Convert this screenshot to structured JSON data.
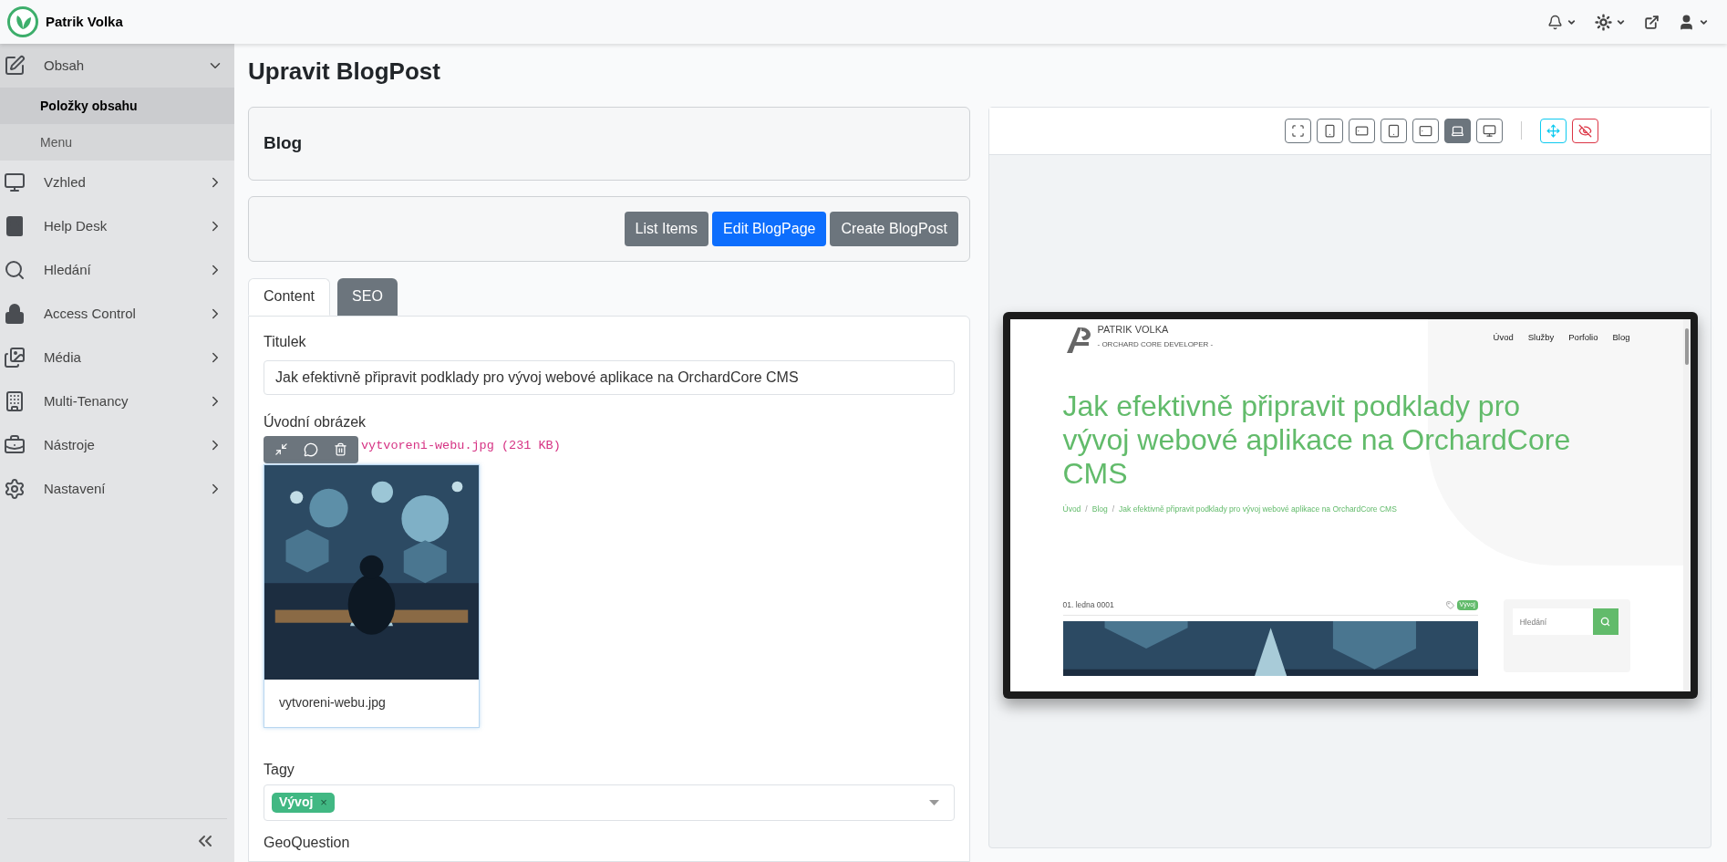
{
  "app": {
    "brand": "Patrik Volka"
  },
  "sidebar": {
    "items": [
      {
        "label": "Obsah",
        "expanded": true,
        "children": [
          {
            "label": "Položky obsahu",
            "selected": true
          },
          {
            "label": "Menu",
            "selected": false
          }
        ]
      },
      {
        "label": "Vzhled",
        "expanded": false
      },
      {
        "label": "Help Desk",
        "expanded": false
      },
      {
        "label": "Hledání",
        "expanded": false
      },
      {
        "label": "Access Control",
        "expanded": false
      },
      {
        "label": "Média",
        "expanded": false
      },
      {
        "label": "Multi-Tenancy",
        "expanded": false
      },
      {
        "label": "Nástroje",
        "expanded": false
      },
      {
        "label": "Nastavení",
        "expanded": false
      }
    ]
  },
  "page_title": "Upravit BlogPost",
  "list_card": {
    "title": "Blog"
  },
  "actions": [
    {
      "label": "List Items",
      "kind": "secondary"
    },
    {
      "label": "Edit BlogPage",
      "kind": "primary"
    },
    {
      "label": "Create BlogPost",
      "kind": "secondary"
    }
  ],
  "tabs": [
    {
      "label": "Content",
      "selected": true
    },
    {
      "label": "SEO",
      "selected": false
    }
  ],
  "form": {
    "title_label": "Titulek",
    "title_value": "Jak efektivně připravit podklady pro vývoj webové aplikace na OrchardCore CMS",
    "image_label": "Úvodní obrázek",
    "file_info": "vytvoreni-webu.jpg (231 KB)",
    "image_caption": "vytvoreni-webu.jpg",
    "tags_label": "Tagy",
    "tags": [
      "Vývoj"
    ],
    "tag_remove": "×",
    "next_label": "GeoQuestion"
  },
  "preview": {
    "devices": [
      {
        "kind": "fullscreen",
        "selected": false
      },
      {
        "kind": "phone",
        "selected": false
      },
      {
        "kind": "phone-landscape",
        "selected": false
      },
      {
        "kind": "tablet",
        "selected": false
      },
      {
        "kind": "tablet-landscape",
        "selected": false
      },
      {
        "kind": "laptop",
        "selected": true
      },
      {
        "kind": "desktop",
        "selected": false
      }
    ],
    "site": {
      "logo_name": "PATRIK VOLKA",
      "logo_sub": "- ORCHARD CORE DEVELOPER -",
      "nav": [
        "Úvod",
        "Služby",
        "Porfolio",
        "Blog"
      ],
      "heading": "Jak efektivně připravit podklady pro vývoj webové aplikace na OrchardCore CMS",
      "breadcrumbs": {
        "separator": "/",
        "items": [
          "Úvod",
          "Blog",
          "Jak efektivně připravit podklady pro vývoj webové aplikace na OrchardCore CMS"
        ]
      },
      "date": "01. ledna 0001",
      "tag": "Vývoj",
      "search_placeholder": "Hledání"
    }
  }
}
